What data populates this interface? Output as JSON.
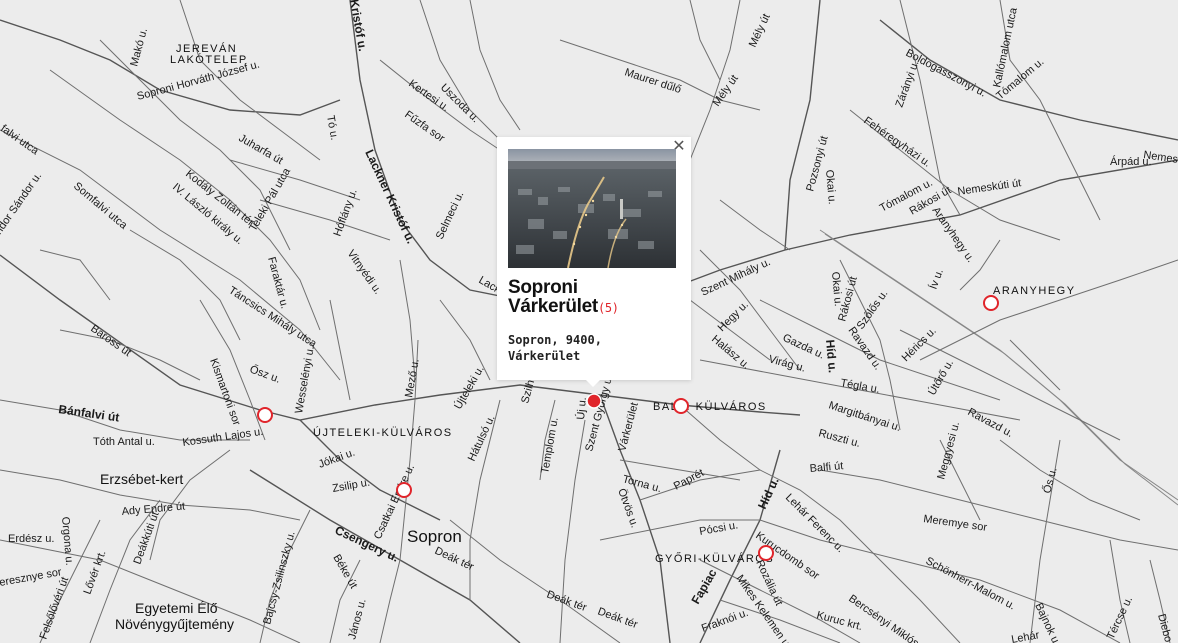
{
  "map": {
    "city_label": "Sopron",
    "districts": {
      "jerevan": [
        "JEREVÁN",
        "LAKÓTELEP"
      ],
      "ujteleki": "ÚJTELEKI-KÜLVÁROS",
      "balf": "BALFI KÜLVÁROS",
      "gyori": "GYŐRI-KÜLVÁROS",
      "aranyhegy": "ARANYHEGY"
    },
    "places": {
      "erzsebet_kert": "Erzsébet-kert",
      "egyetemi": [
        "Egyetemi Élő",
        "Növénygyűjtemény"
      ]
    },
    "streets": {
      "mako": "Makó u.",
      "horvath": "Soproni Horváth József u.",
      "kristof_top": "Kristóf u.",
      "kertesi": "Kertesi u.",
      "uszoda": "Uszoda u.",
      "fuzfa": "Fűzfa sor",
      "maurer": "Maurer dűlő",
      "mely1": "Mély út",
      "mely2": "Mély út",
      "boldogasszony": "Boldogasszonyi u.",
      "kallomalom": "Kallómalom utca",
      "tomalom_top": "Tómalom u.",
      "zaranyi": "Zárányi u.",
      "nemeskut_edge": "Nemesk",
      "falvi": "falvi utca",
      "juharfa": "Juharfa út",
      "to": "Tó u.",
      "lackner_1": "Lackner Kristóf u.",
      "feheregyhazi": "Fehéregyházi u.",
      "pozsonyi": "Pozsonyi út",
      "okai_1": "Okai u.",
      "tomalom_2": "Tómalom u.",
      "rakosi_1": "Rákosi út",
      "nemeskuti": "Nemeskúti út",
      "sandor": "ndor Sándor u.",
      "somfalvi": "Somfalvi utca",
      "kodaly": "Kodály Zoltán tér",
      "laszlo": "IV. László király u.",
      "teleki": "Teleki Pál utca",
      "hoflany": "Hóflány u.",
      "selmeci": "Selmeci u.",
      "aranyhegy_u": "Aranyhegy u.",
      "iv": "Ív u.",
      "vitnyedi": "Vitnyédi u.",
      "faraktar": "Faraktár u.",
      "lack_partial": "Lack",
      "szent_mihaly": "Szent Mihály u.",
      "okai_2": "Okai u.",
      "rakosi_2": "Rákosi út",
      "szolos": "Szőlős u.",
      "tancsics": "Táncsics Mihály utca",
      "baross": "Baross út",
      "hegy": "Hegy u.",
      "gazda": "Gazda u.",
      "ravazd_1": "Ravazd u.",
      "hid_1": "Híd u.",
      "herics": "Hérics u.",
      "halasz": "Halász u.",
      "virag": "Virág u.",
      "tegla": "Tégla u.",
      "utoro": "Útőrő u.",
      "osz": "Ősz u.",
      "kismartoni": "Kismartoni sor",
      "wesselenyi": "Wesselényi u.",
      "mezo": "Mező u.",
      "ujteleki_u": "Újteleki u.",
      "szilh": "Szilh",
      "uj": "Új u.",
      "szent_gyorgy": "Szent György u.",
      "vartkerulet_st": "Várkerület",
      "margitbanyai": "Margitbányai u.",
      "ravazd_2": "Ravazd u.",
      "banfalvi": "Bánfalvi út",
      "toth": "Tóth Antal u.",
      "kossuth": "Kossuth Lajos u.",
      "jokai": "Jókai u.",
      "hatulso": "Hátulsó u.",
      "templom": "Templom u.",
      "ruszti": "Ruszti u.",
      "meggyesi": "Meggyesi u.",
      "balfi_ut": "Balfi út",
      "torna": "Torna u.",
      "papret": "Paprét",
      "os": "Ős u.",
      "zsilip": "Zsilip u.",
      "csatkai": "Csatkai Endre u.",
      "otvos": "Ötvös u.",
      "hid_2": "Híd u.",
      "lehar": "Lehár Ferenc u.",
      "arpad": "Árpád u.",
      "ady": "Ady Endre út",
      "erdesz": "Erdész u.",
      "orgona": "Orgona u.",
      "meremye": "Meremye sor",
      "pocsi": "Pócsi u.",
      "kurucdomb": "Kurucdomb sor",
      "csengery": "Csengery u.",
      "deak_1": "Deák tér",
      "deakkuti": "Deákkúti út",
      "lover": "Lővér krt.",
      "cseresznye": "eresznye sor",
      "bajcsy": "Bajcsy-Zsilinszky u.",
      "beke": "Béke út",
      "fapiac": "Fapiac",
      "rozalia": "Rozália út",
      "mikes": "Mikes Kelemen u.",
      "schonherr": "Schönherr-Malom u.",
      "deak_2": "Deák tér",
      "deak_3": "Deák tér",
      "felsoloveri": "Felsőlővéri út",
      "janos": "János u.",
      "fraknoi": "Fraknói u.",
      "kuruc_krt": "Kuruc krt.",
      "bercsenyi": "Bercsényi Miklós u.",
      "bajnok": "Bajnok u.",
      "lehar_edge": "Lehár",
      "tercse": "Tércse u.",
      "diebo": "Diebo"
    }
  },
  "popup": {
    "title_line1": "Soproni",
    "title_line2": "Várkerület",
    "count": "(5)",
    "address_line1": "Sopron, 9400,",
    "address_line2": "Várkerület",
    "close_glyph": "✕"
  },
  "colors": {
    "marker": "#e0252b",
    "background": "#ececec",
    "road": "#6f6f6f"
  },
  "icons": {
    "close": "close-icon",
    "marker": "map-marker-icon"
  }
}
